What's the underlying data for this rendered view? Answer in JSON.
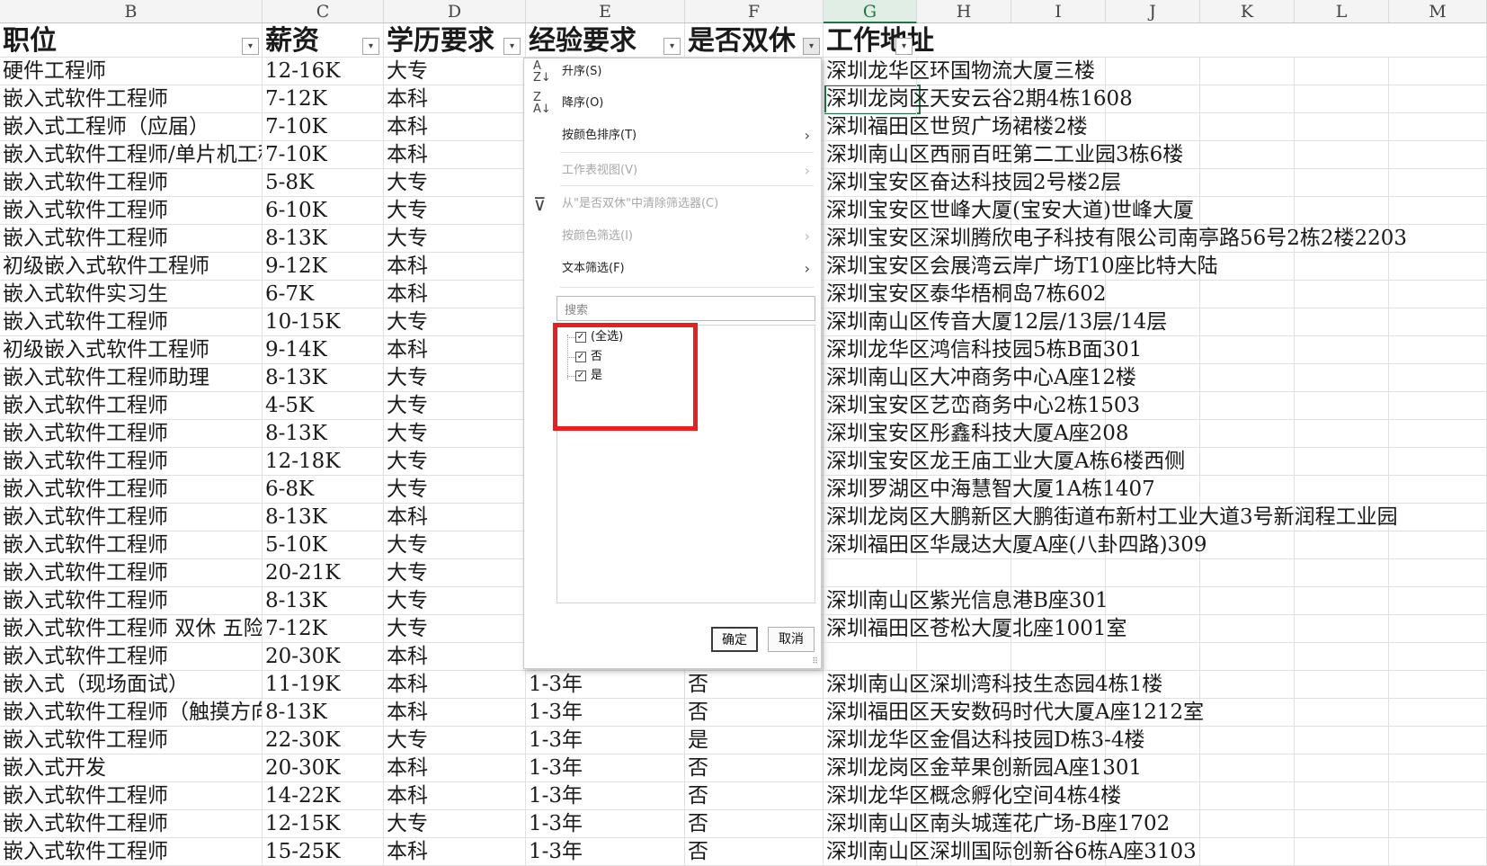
{
  "columns": [
    "B",
    "C",
    "D",
    "E",
    "F",
    "G",
    "H",
    "I",
    "J",
    "K",
    "L",
    "M"
  ],
  "selected_column": "G",
  "header": [
    "职位",
    "薪资",
    "学历要求",
    "经验要求",
    "是否双休",
    "工作地址"
  ],
  "rows": [
    {
      "job": "硬件工程师",
      "salary": "12-16K",
      "edu": "大专",
      "exp": "",
      "rest": "",
      "addr": "深圳龙华区环国物流大厦三楼"
    },
    {
      "job": "嵌入式软件工程师",
      "salary": "7-12K",
      "edu": "本科",
      "exp": "",
      "rest": "",
      "addr": "深圳龙岗区天安云谷2期4栋1608"
    },
    {
      "job": "嵌入式工程师（应届）",
      "salary": "7-10K",
      "edu": "本科",
      "exp": "",
      "rest": "",
      "addr": "深圳福田区世贸广场裙楼2楼"
    },
    {
      "job": "嵌入式软件工程师/单片机工程师",
      "salary": "7-10K",
      "edu": "本科",
      "exp": "",
      "rest": "",
      "addr": "深圳南山区西丽百旺第二工业园3栋6楼"
    },
    {
      "job": "嵌入式软件工程师",
      "salary": "5-8K",
      "edu": "大专",
      "exp": "",
      "rest": "",
      "addr": "深圳宝安区奋达科技园2号楼2层"
    },
    {
      "job": "嵌入式软件工程师",
      "salary": "6-10K",
      "edu": "大专",
      "exp": "",
      "rest": "",
      "addr": "深圳宝安区世峰大厦(宝安大道)世峰大厦"
    },
    {
      "job": "嵌入式软件工程师",
      "salary": "8-13K",
      "edu": "大专",
      "exp": "",
      "rest": "",
      "addr": "深圳宝安区深圳腾欣电子科技有限公司南亭路56号2栋2楼2203"
    },
    {
      "job": "初级嵌入式软件工程师",
      "salary": "9-12K",
      "edu": "本科",
      "exp": "",
      "rest": "",
      "addr": "深圳宝安区会展湾云岸广场T10座比特大陆"
    },
    {
      "job": "嵌入式软件实习生",
      "salary": "6-7K",
      "edu": "本科",
      "exp": "",
      "rest": "",
      "addr": "深圳宝安区泰华梧桐岛7栋602"
    },
    {
      "job": "嵌入式软件工程师",
      "salary": "10-15K",
      "edu": "大专",
      "exp": "",
      "rest": "",
      "addr": "深圳南山区传音大厦12层/13层/14层"
    },
    {
      "job": "初级嵌入式软件工程师",
      "salary": "9-14K",
      "edu": "本科",
      "exp": "",
      "rest": "",
      "addr": "深圳龙华区鸿信科技园5栋B面301"
    },
    {
      "job": "嵌入式软件工程师助理",
      "salary": "8-13K",
      "edu": "大专",
      "exp": "",
      "rest": "",
      "addr": "深圳南山区大冲商务中心A座12楼"
    },
    {
      "job": "嵌入式软件工程师",
      "salary": "4-5K",
      "edu": "大专",
      "exp": "",
      "rest": "",
      "addr": "深圳宝安区艺峦商务中心2栋1503"
    },
    {
      "job": "嵌入式软件工程师",
      "salary": "8-13K",
      "edu": "大专",
      "exp": "",
      "rest": "",
      "addr": "深圳宝安区彤鑫科技大厦A座208"
    },
    {
      "job": "嵌入式软件工程师",
      "salary": "12-18K",
      "edu": "大专",
      "exp": "",
      "rest": "",
      "addr": "深圳宝安区龙王庙工业大厦A栋6楼西侧"
    },
    {
      "job": "嵌入式软件工程师",
      "salary": "6-8K",
      "edu": "大专",
      "exp": "",
      "rest": "",
      "addr": "深圳罗湖区中海慧智大厦1A栋1407"
    },
    {
      "job": "嵌入式软件工程师",
      "salary": "8-13K",
      "edu": "本科",
      "exp": "",
      "rest": "",
      "addr": "深圳龙岗区大鹏新区大鹏街道布新村工业大道3号新润程工业园"
    },
    {
      "job": "嵌入式软件工程师",
      "salary": "5-10K",
      "edu": "大专",
      "exp": "",
      "rest": "",
      "addr": "深圳福田区华晟达大厦A座(八卦四路)309"
    },
    {
      "job": "嵌入式软件工程师",
      "salary": "20-21K",
      "edu": "大专",
      "exp": "",
      "rest": "",
      "addr": ""
    },
    {
      "job": "嵌入式软件工程师",
      "salary": "8-13K",
      "edu": "大专",
      "exp": "",
      "rest": "",
      "addr": "深圳南山区紫光信息港B座301"
    },
    {
      "job": "嵌入式软件工程师 双休 五险",
      "salary": "7-12K",
      "edu": "大专",
      "exp": "",
      "rest": "",
      "addr": "深圳福田区苍松大厦北座1001室"
    },
    {
      "job": "嵌入式软件工程师",
      "salary": "20-30K",
      "edu": "本科",
      "exp": "",
      "rest": "",
      "addr": ""
    },
    {
      "job": "嵌入式（现场面试）",
      "salary": "11-19K",
      "edu": "本科",
      "exp": "1-3年",
      "rest": "否",
      "addr": "深圳南山区深圳湾科技生态园4栋1楼"
    },
    {
      "job": "嵌入式软件工程师（触摸方向）",
      "salary": "8-13K",
      "edu": "本科",
      "exp": "1-3年",
      "rest": "否",
      "addr": "深圳福田区天安数码时代大厦A座1212室"
    },
    {
      "job": "嵌入式软件工程师",
      "salary": "22-30K",
      "edu": "大专",
      "exp": "1-3年",
      "rest": "是",
      "addr": "深圳龙华区金倡达科技园D栋3-4楼"
    },
    {
      "job": "嵌入式开发",
      "salary": "20-30K",
      "edu": "本科",
      "exp": "1-3年",
      "rest": "否",
      "addr": "深圳龙岗区金苹果创新园A座1301"
    },
    {
      "job": "嵌入式软件工程师",
      "salary": "14-22K",
      "edu": "本科",
      "exp": "1-3年",
      "rest": "否",
      "addr": "深圳龙华区概念孵化空间4栋4楼"
    },
    {
      "job": "嵌入式软件工程师",
      "salary": "12-15K",
      "edu": "大专",
      "exp": "1-3年",
      "rest": "否",
      "addr": "深圳南山区南头城莲花广场-B座1702"
    },
    {
      "job": "嵌入式软件工程师",
      "salary": "15-25K",
      "edu": "本科",
      "exp": "1-3年",
      "rest": "否",
      "addr": "深圳南山区深圳国际创新谷6栋A座3103"
    }
  ],
  "filter_menu": {
    "sort_asc": "升序(S)",
    "sort_desc": "降序(O)",
    "sort_by_color": "按颜色排序(T)",
    "sheet_view": "工作表视图(V)",
    "clear_filter": "从\"是否双休\"中清除筛选器(C)",
    "filter_by_color": "按颜色筛选(I)",
    "text_filter": "文本筛选(F)",
    "search_placeholder": "搜索",
    "options": [
      {
        "label": "(全选)",
        "checked": true
      },
      {
        "label": "否",
        "checked": true
      },
      {
        "label": "是",
        "checked": true
      }
    ],
    "ok": "确定",
    "cancel": "取消"
  },
  "colors": {
    "highlight_box": "#ee1d1d",
    "excel_green": "#217346"
  }
}
